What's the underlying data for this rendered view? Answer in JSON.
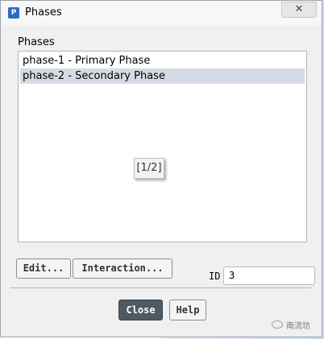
{
  "window": {
    "title": "Phases",
    "app_icon": "P",
    "close_glyph": "✕"
  },
  "phases": {
    "group_label": "Phases",
    "items": [
      {
        "label": "phase-1 - Primary Phase",
        "selected": false
      },
      {
        "label": "phase-2 - Secondary Phase",
        "selected": true
      }
    ],
    "tooltip": "[1/2]"
  },
  "actions": {
    "edit_label": "Edit...",
    "interaction_label": "Interaction...",
    "id_label": "ID",
    "id_value": "3"
  },
  "footer": {
    "close_label": "Close",
    "help_label": "Help"
  },
  "watermark": {
    "text": "南流坊",
    "icon": "wechat-icon"
  }
}
